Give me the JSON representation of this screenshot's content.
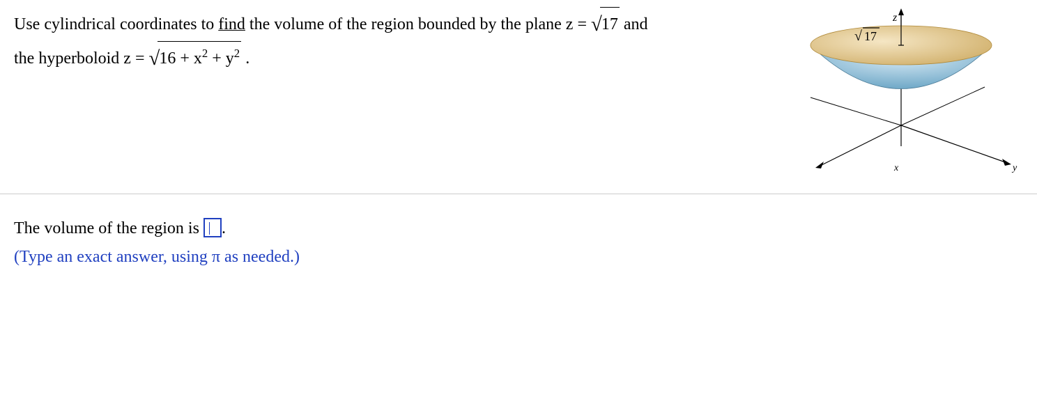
{
  "question": {
    "part1_pre": "Use cylindrical coordinates to ",
    "part1_find": "find",
    "part1_post": " the volume of the region bounded by the plane z = ",
    "sqrt17": "17",
    "part1_end": "  and",
    "part2_pre": "the hyperboloid z = ",
    "radicand2_a": "16 + x",
    "radicand2_b": " + y",
    "part2_end": " ."
  },
  "figure": {
    "z_label": "z",
    "y_label": "y",
    "x_label": "x",
    "sqrt17_label": "17",
    "surd": "√"
  },
  "answer": {
    "prompt_pre": "The volume of the region is ",
    "prompt_post": ".",
    "hint": "(Type an exact answer, using π as needed.)"
  }
}
